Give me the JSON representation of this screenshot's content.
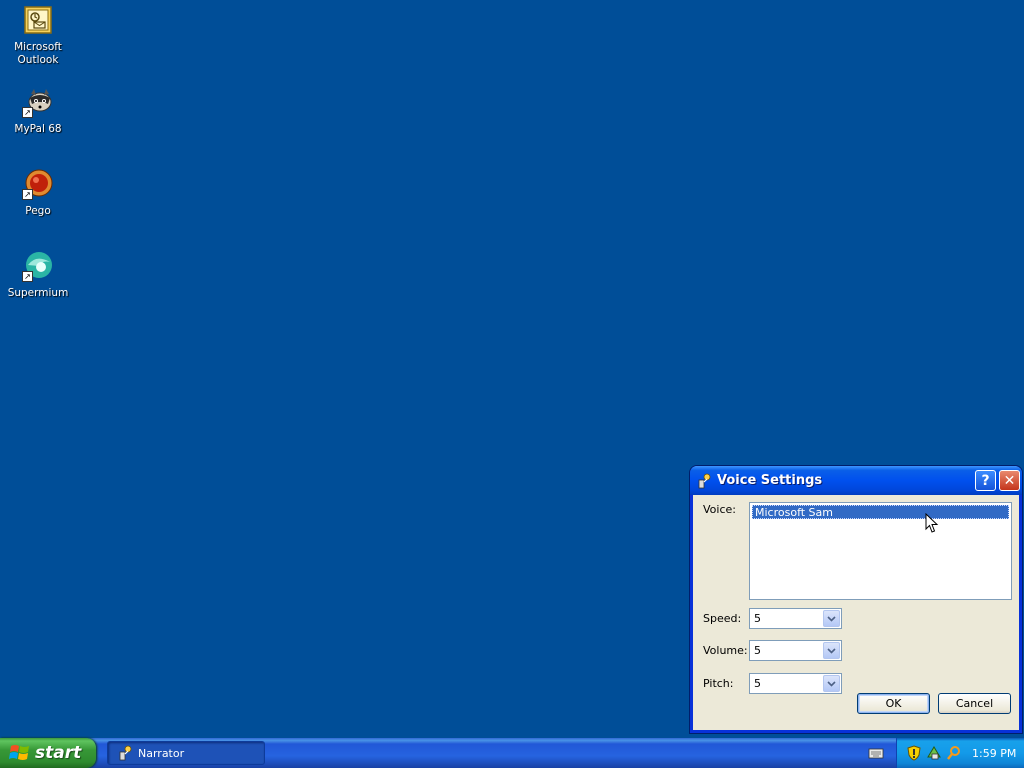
{
  "desktop": {
    "icons": [
      {
        "label": "Microsoft Outlook",
        "icon": "outlook-icon"
      },
      {
        "label": "MyPal 68",
        "icon": "mypal-icon"
      },
      {
        "label": "Pego",
        "icon": "pego-icon"
      },
      {
        "label": "Supermium",
        "icon": "supermium-icon"
      }
    ],
    "background_color": "#004e98"
  },
  "dialog": {
    "title": "Voice Settings",
    "help_glyph": "?",
    "close_glyph": "✕",
    "voice_label": "Voice:",
    "voices": [
      "Microsoft Sam"
    ],
    "selected_voice": "Microsoft Sam",
    "speed_label": "Speed:",
    "speed_value": "5",
    "volume_label": "Volume:",
    "volume_value": "5",
    "pitch_label": "Pitch:",
    "pitch_value": "5",
    "ok_label": "OK",
    "cancel_label": "Cancel"
  },
  "taskbar": {
    "start_label": "start",
    "tasks": [
      {
        "label": "Narrator",
        "icon": "narrator-icon"
      }
    ],
    "tray_icons": [
      "security-shield-icon",
      "network-icon",
      "search-icon"
    ],
    "clock": "1:59 PM"
  },
  "colors": {
    "titlebar": "#0050ee",
    "selection": "#316ac5",
    "start_green": "#379837",
    "taskbar_blue": "#2663e0"
  }
}
